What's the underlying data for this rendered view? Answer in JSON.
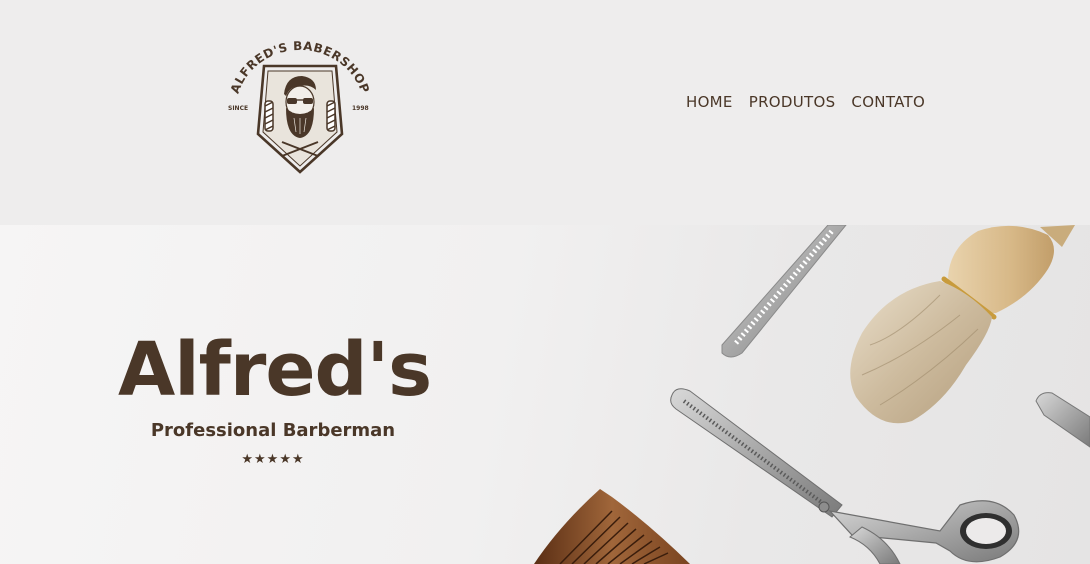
{
  "logo": {
    "arc_text": "ALFRED'S BABERSHOP",
    "since_label": "SINCE",
    "year": "1998"
  },
  "nav": {
    "home": "HOME",
    "produtos": "PRODUTOS",
    "contato": "CONTATO"
  },
  "hero": {
    "title": "Alfred's",
    "subtitle": "Professional Barberman",
    "stars": "★★★★★",
    "rating": 5
  },
  "colors": {
    "brand_brown": "#4a3728",
    "header_bg": "#eeeded",
    "hero_bg": "#f3f2f2"
  },
  "icons": {
    "logo": "barbershop-badge-icon",
    "tools": [
      "thinning-comb-icon",
      "shaving-brush-icon",
      "thinning-scissors-icon",
      "wooden-comb-icon",
      "razor-icon"
    ]
  }
}
